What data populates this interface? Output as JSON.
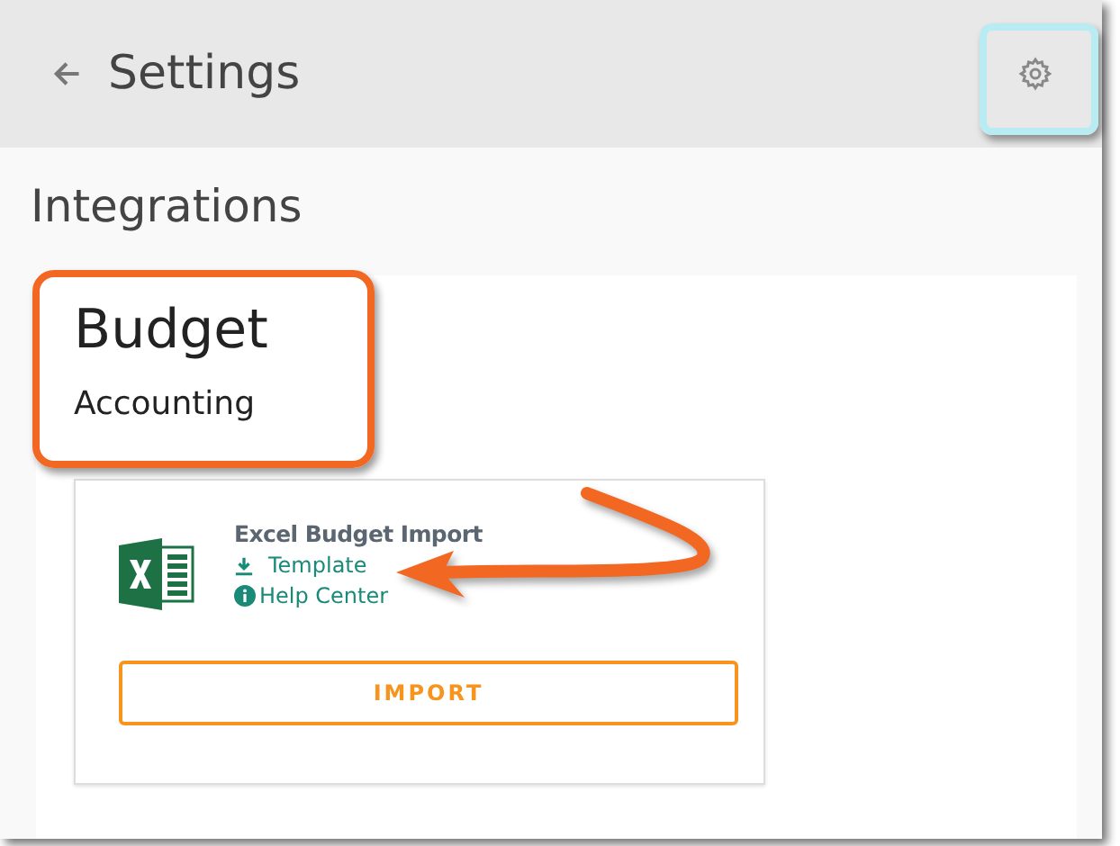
{
  "header": {
    "title": "Settings"
  },
  "section_title": "Integrations",
  "panel": {
    "title": "Budget",
    "subtitle": "Accounting"
  },
  "card": {
    "title": "Excel Budget Import",
    "links": [
      {
        "kind": "download",
        "label": "Template"
      },
      {
        "kind": "info",
        "label": "Help Center"
      }
    ],
    "button": "IMPORT"
  }
}
